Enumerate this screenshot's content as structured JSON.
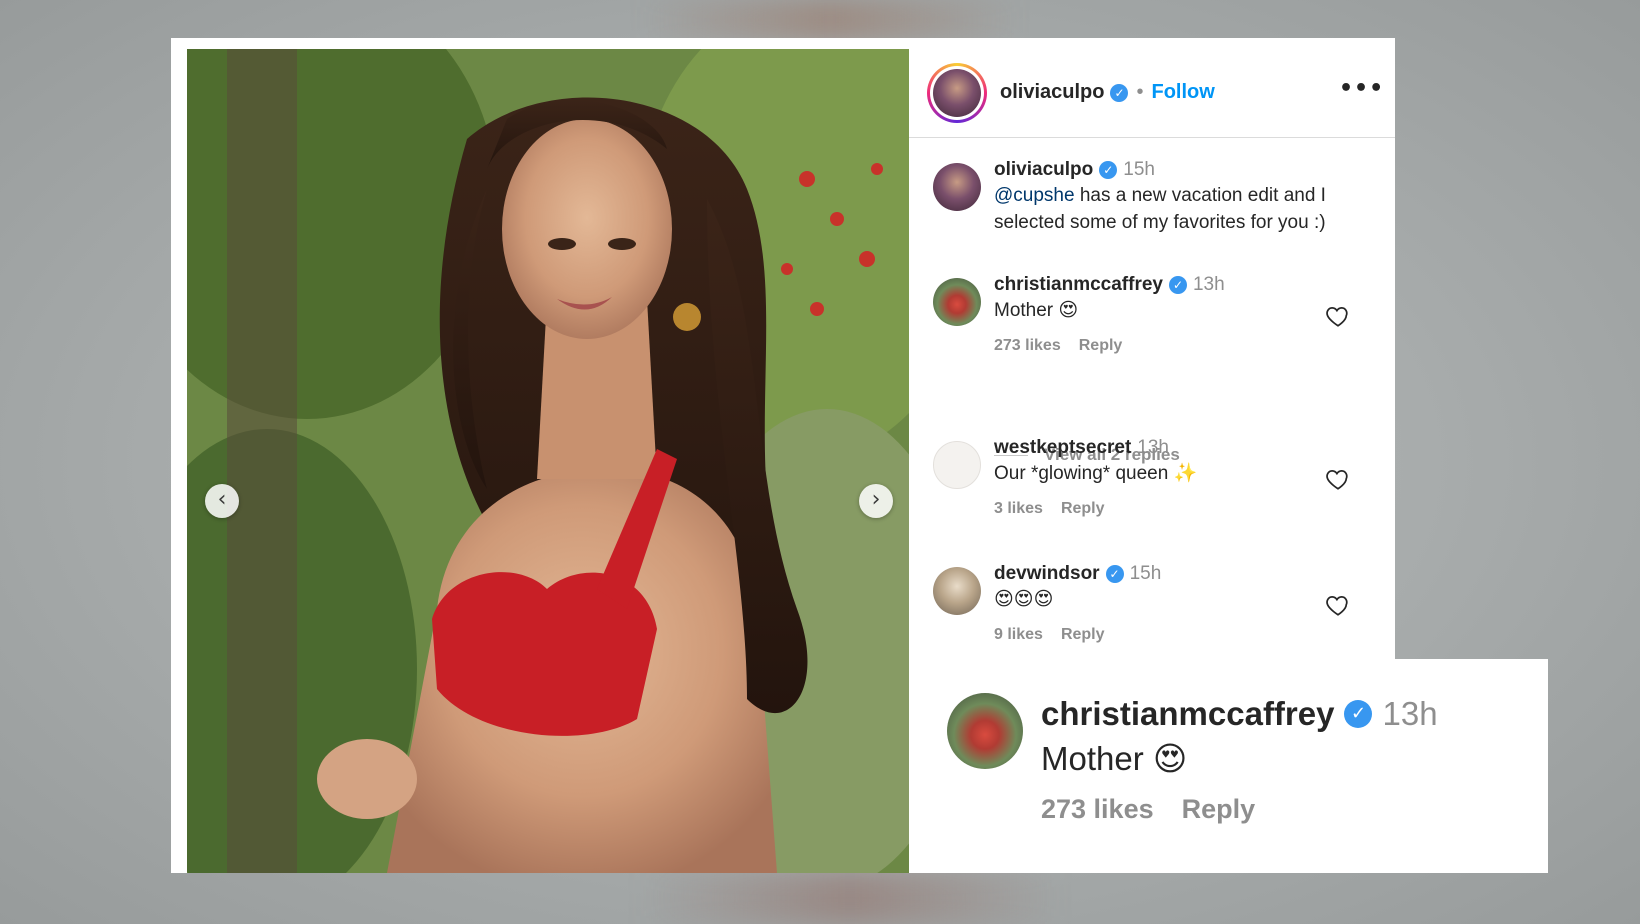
{
  "post": {
    "author": "oliviaculpo",
    "follow_label": "Follow",
    "separator": "•",
    "more_label": "•••"
  },
  "caption": {
    "username": "oliviaculpo",
    "time": "15h",
    "mention": "@cupshe",
    "text": " has a new vacation edit and I selected some of my favorites for you :)"
  },
  "comments": [
    {
      "username": "christianmccaffrey",
      "verified": true,
      "time": "13h",
      "text": "Mother 😍",
      "likes": "273 likes",
      "reply_label": "Reply"
    },
    {
      "username": "westkeptsecret",
      "verified": false,
      "time": "13h",
      "text": "Our *glowing* queen ✨",
      "likes": "3 likes",
      "reply_label": "Reply"
    },
    {
      "username": "devwindsor",
      "verified": true,
      "time": "15h",
      "text": "😍😍😍",
      "likes": "9 likes",
      "reply_label": "Reply"
    }
  ],
  "view_replies_label": "View all 2 replies",
  "zoom": {
    "username": "christianmccaffrey",
    "time": "13h",
    "text": "Mother 😍",
    "likes": "273 likes",
    "reply_label": "Reply"
  },
  "verified_glyph": "✓",
  "carousel": {
    "prev_glyph": "‹",
    "next_glyph": "›"
  },
  "colors": {
    "link_blue": "#0095f6",
    "verified_blue": "#3897f0",
    "secondary_text": "#8e8e8e",
    "primary_text": "#262626"
  },
  "icons": [
    "story-avatar-icon",
    "verified-icon",
    "more-options-icon",
    "heart-icon",
    "carousel-prev-icon",
    "carousel-next-icon"
  ]
}
